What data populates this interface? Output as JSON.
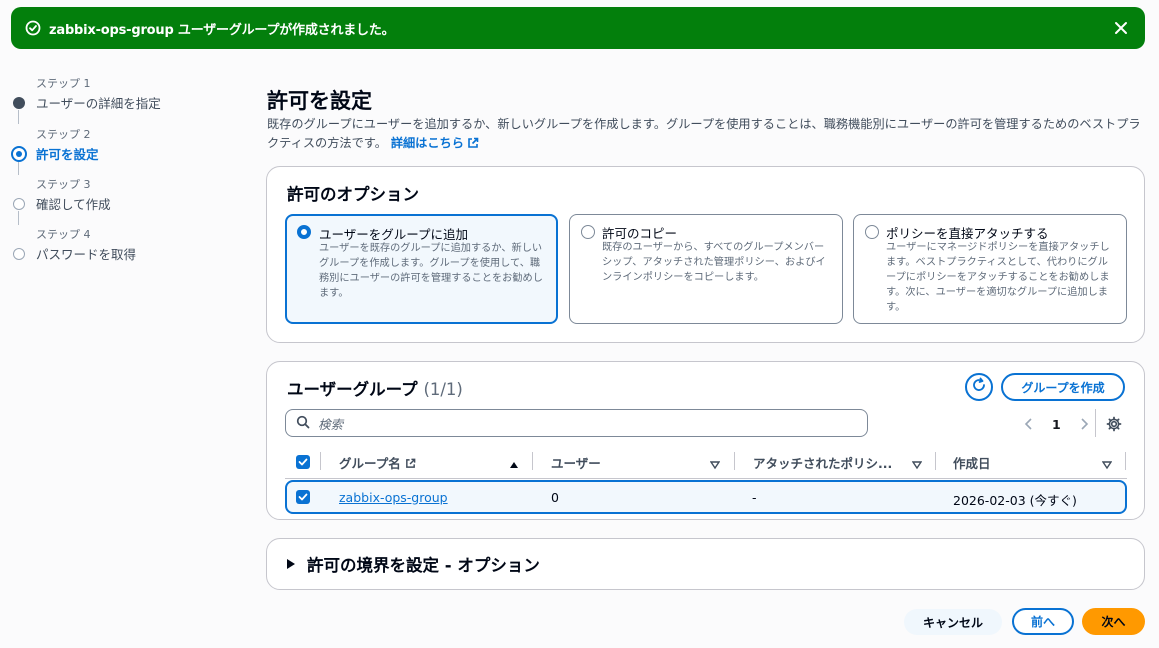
{
  "flash": {
    "message": "zabbix-ops-group ユーザーグループが作成されました。"
  },
  "steps": [
    {
      "num": "ステップ 1",
      "label": "ユーザーの詳細を指定",
      "state": "done"
    },
    {
      "num": "ステップ 2",
      "label": "許可を設定",
      "state": "current"
    },
    {
      "num": "ステップ 3",
      "label": "確認して作成",
      "state": "todo"
    },
    {
      "num": "ステップ 4",
      "label": "パスワードを取得",
      "state": "todo"
    }
  ],
  "page": {
    "title": "許可を設定",
    "description": "既存のグループにユーザーを追加するか、新しいグループを作成します。グループを使用することは、職務機能別にユーザーの許可を管理するためのベストプラクティスの方法です。",
    "learn_more": "詳細はこちら"
  },
  "options": {
    "title": "許可のオプション",
    "tiles": [
      {
        "title": "ユーザーをグループに追加",
        "body": "ユーザーを既存のグループに追加するか、新しいグループを作成します。グループを使用して、職務別にユーザーの許可を管理することをお勧めします。"
      },
      {
        "title": "許可のコピー",
        "body": "既存のユーザーから、すべてのグループメンバーシップ、アタッチされた管理ポリシー、およびインラインポリシーをコピーします。"
      },
      {
        "title": "ポリシーを直接アタッチする",
        "body": "ユーザーにマネージドポリシーを直接アタッチします。ベストプラクティスとして、代わりにグループにポリシーをアタッチすることをお勧めします。次に、ユーザーを適切なグループに追加します。"
      }
    ]
  },
  "groups": {
    "title": "ユーザーグループ",
    "count": "(1/1)",
    "create_label": "グループを作成",
    "search_placeholder": "検索",
    "page_number": "1",
    "columns": [
      "グループ名",
      "ユーザー",
      "アタッチされたポリシ...",
      "作成日"
    ],
    "rows": [
      {
        "name": "zabbix-ops-group",
        "users": "0",
        "policies": "-",
        "created": "2026-02-03 (今すぐ)"
      }
    ]
  },
  "boundary": {
    "title": "許可の境界を設定 - オプション"
  },
  "footer": {
    "cancel": "キャンセル",
    "prev": "前へ",
    "next": "次へ"
  },
  "colors": {
    "success": "#037f0c",
    "accent": "#0972d3",
    "primary": "#ff9900"
  }
}
